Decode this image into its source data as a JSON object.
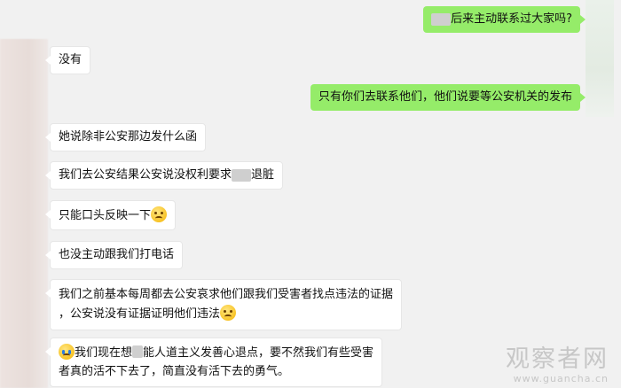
{
  "messages": [
    {
      "side": "right",
      "pre": "",
      "blur": "某某",
      "post": "后来主动联系过大家吗?"
    },
    {
      "side": "left",
      "text": "没有"
    },
    {
      "side": "right",
      "text": "只有你们去联系他们，他们说要等公安机关的发布"
    },
    {
      "side": "left",
      "text": "她说除非公安那边发什么函"
    },
    {
      "side": "left",
      "pre": "我们去公安结果公安说没权利要求",
      "blur": "某某",
      "post": "退脏"
    },
    {
      "side": "left",
      "text": "只能口头反映一下"
    },
    {
      "side": "left",
      "text": "也没主动跟我们打电话"
    },
    {
      "side": "left",
      "line1": "我们之前基本每周都去公安哀求他们跟我们受害者找点违法的证据",
      "line2": "，公安说没有证据证明他们违法"
    },
    {
      "side": "left",
      "line1_pre": "我们现在想",
      "line1_blur": "某某",
      "line1_post": "能人道主义发善心退点，要不然我们有些受害",
      "line2": "者真的活不下去了，简直没有活下去的勇气。"
    }
  ],
  "watermark": {
    "cn": "观察者网",
    "en": "www.guancha.cn"
  }
}
